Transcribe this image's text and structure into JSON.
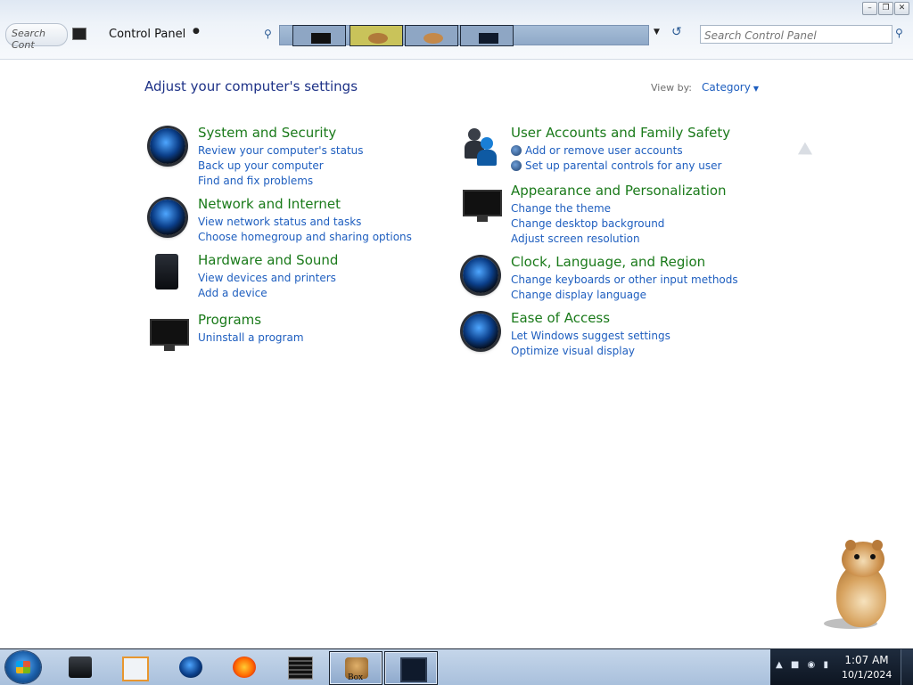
{
  "window": {
    "breadcrumb": "Control Panel",
    "ghost_text": "Search Cont",
    "controls": [
      "minimize",
      "restore",
      "close"
    ]
  },
  "search": {
    "placeholder": "Search Control Panel"
  },
  "heading": "Adjust your computer's settings",
  "view_by": {
    "label": "View by:",
    "value": "Category"
  },
  "categories": [
    {
      "title": "System and Security",
      "icon": "system-security-icon",
      "links": [
        "Review your computer's status",
        "Back up your computer",
        "Find and fix problems"
      ]
    },
    {
      "title": "Network and Internet",
      "icon": "network-internet-icon",
      "links": [
        "View network status and tasks",
        "Choose homegroup and sharing options"
      ]
    },
    {
      "title": "Hardware and Sound",
      "icon": "hardware-sound-icon",
      "links": [
        "View devices and printers",
        "Add a device"
      ]
    },
    {
      "title": "Programs",
      "icon": "programs-icon",
      "links": [
        "Uninstall a program"
      ]
    },
    {
      "title": "User Accounts and Family Safety",
      "icon": "user-accounts-icon",
      "links": [
        "Add or remove user accounts",
        "Set up parental controls for any user"
      ]
    },
    {
      "title": "Appearance and Personalization",
      "icon": "appearance-icon",
      "links": [
        "Change the theme",
        "Change desktop background",
        "Adjust screen resolution"
      ]
    },
    {
      "title": "Clock, Language, and Region",
      "icon": "clock-language-icon",
      "links": [
        "Change keyboards or other input methods",
        "Change display language"
      ]
    },
    {
      "title": "Ease of Access",
      "icon": "ease-of-access-icon",
      "links": [
        "Let Windows suggest settings",
        "Optimize visual display"
      ]
    }
  ],
  "taskbar": {
    "apps": [
      "black-box-app",
      "media-player",
      "globe-app",
      "firefox",
      "list-app",
      "box-app",
      "monitor-app"
    ],
    "box_label": "Box"
  },
  "clock": {
    "time": "1:07 AM",
    "date": "10/1/2024"
  },
  "colors": {
    "link": "#1e5ebf",
    "category_title": "#1a7a1a",
    "heading": "#1e3287"
  }
}
